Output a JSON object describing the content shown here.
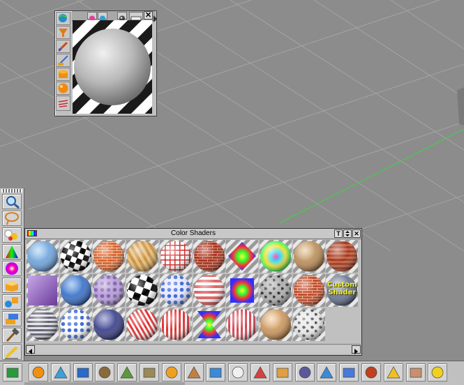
{
  "shader_panel": {
    "title": "Color Shaders",
    "buttons": {
      "type": "T",
      "close": "✕"
    },
    "custom_shader_label": [
      "Custom",
      "Shader"
    ],
    "shaders": [
      {
        "name": "light-blue-plain"
      },
      {
        "name": "black-white-checker"
      },
      {
        "name": "orange-brick"
      },
      {
        "name": "wood-grain"
      },
      {
        "name": "red-grid"
      },
      {
        "name": "red-brick"
      },
      {
        "name": "rainbow-diamond"
      },
      {
        "name": "psychedelic-rainbow"
      },
      {
        "name": "light-wood"
      },
      {
        "name": "dark-red-brick"
      },
      {
        "name": "purple-fur"
      },
      {
        "name": "blue-marble"
      },
      {
        "name": "lilac-spots"
      },
      {
        "name": "checker-large"
      },
      {
        "name": "blue-polka-dots"
      },
      {
        "name": "red-white-stripes"
      },
      {
        "name": "rainbow-square"
      },
      {
        "name": "stone-mottle"
      },
      {
        "name": "red-brick-2"
      },
      {
        "name": "custom-shader"
      },
      {
        "name": "grey-rings"
      },
      {
        "name": "white-blue-dots"
      },
      {
        "name": "navy-speckle"
      },
      {
        "name": "red-thin-stripes"
      },
      {
        "name": "red-vertical-stripes"
      },
      {
        "name": "rainbow-hourglass"
      },
      {
        "name": "pink-stripes"
      },
      {
        "name": "tan-wood"
      },
      {
        "name": "grey-camo"
      }
    ]
  },
  "material_window": {
    "close": "✕",
    "tools": [
      "globe-icon",
      "funnel-icon",
      "brush-icon",
      "pen-icon",
      "cylinder-icon",
      "orange-sphere-icon",
      "shader-sphere-icon"
    ],
    "tabs": [
      "color-tab-icon",
      "globe-tab-icon",
      "render-tab-icon",
      "swatch-tab-icon"
    ]
  },
  "left_toolbar": {
    "tools": [
      "magnify-icon",
      "lasso-icon",
      "paint-balls-icon",
      "rainbow-triangle-icon",
      "color-sphere-icon",
      "box-open-icon",
      "shapes-icon",
      "stack-icon",
      "hammer-icon",
      "pencil-icon"
    ]
  },
  "bottom_toolbar": {
    "tools": [
      "recycle-icon",
      "orange-box-icon",
      "spotlight-icon",
      "camera-icon",
      "layers-icon",
      "terrain-icon",
      "texture-icon",
      "parrot-icon",
      "crate-icon",
      "folder-icon",
      "heart-icon",
      "spray-icon",
      "palette-icon",
      "tools-icon",
      "ruler-icon",
      "mesh-icon",
      "axis-icon",
      "logo-m-icon",
      "face-icon",
      "plug-icon"
    ]
  },
  "colors": {
    "viewport_bg": "#8c8c8c",
    "grid_line": "#a6a6a6",
    "panel_bg": "#c0c0c0",
    "axis_green": "#3cd63c"
  }
}
